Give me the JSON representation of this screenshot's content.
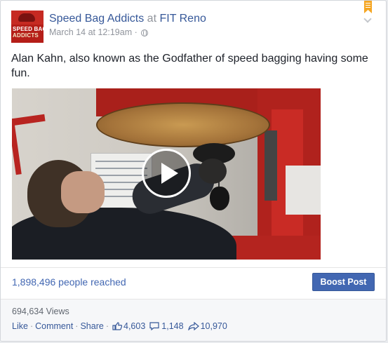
{
  "post": {
    "page_name": "Speed Bag Addicts",
    "at_word": "at",
    "location": "FIT Reno",
    "timestamp": "March 14 at 12:19am",
    "dot": "·",
    "avatar_line1": "SPEED BAG",
    "avatar_line2": "ADDICTS",
    "text": "Alan Kahn, also known as the Godfather of speed bagging having some fun.",
    "video_label": "",
    "colors": {
      "link": "#365899",
      "boost": "#4267b2",
      "bookmark": "#f5a623"
    }
  },
  "stats": {
    "reach": "1,898,496 people reached",
    "boost_label": "Boost Post",
    "views": "694,634 Views"
  },
  "actions": {
    "like": "Like",
    "comment": "Comment",
    "share": "Share",
    "sep": "·",
    "like_count": "4,603",
    "comment_count": "1,148",
    "share_count": "10,970"
  },
  "icons": [
    "globe-icon",
    "bookmark-icon",
    "chevron-down-icon",
    "play-icon",
    "like-icon",
    "comment-icon",
    "share-icon"
  ]
}
